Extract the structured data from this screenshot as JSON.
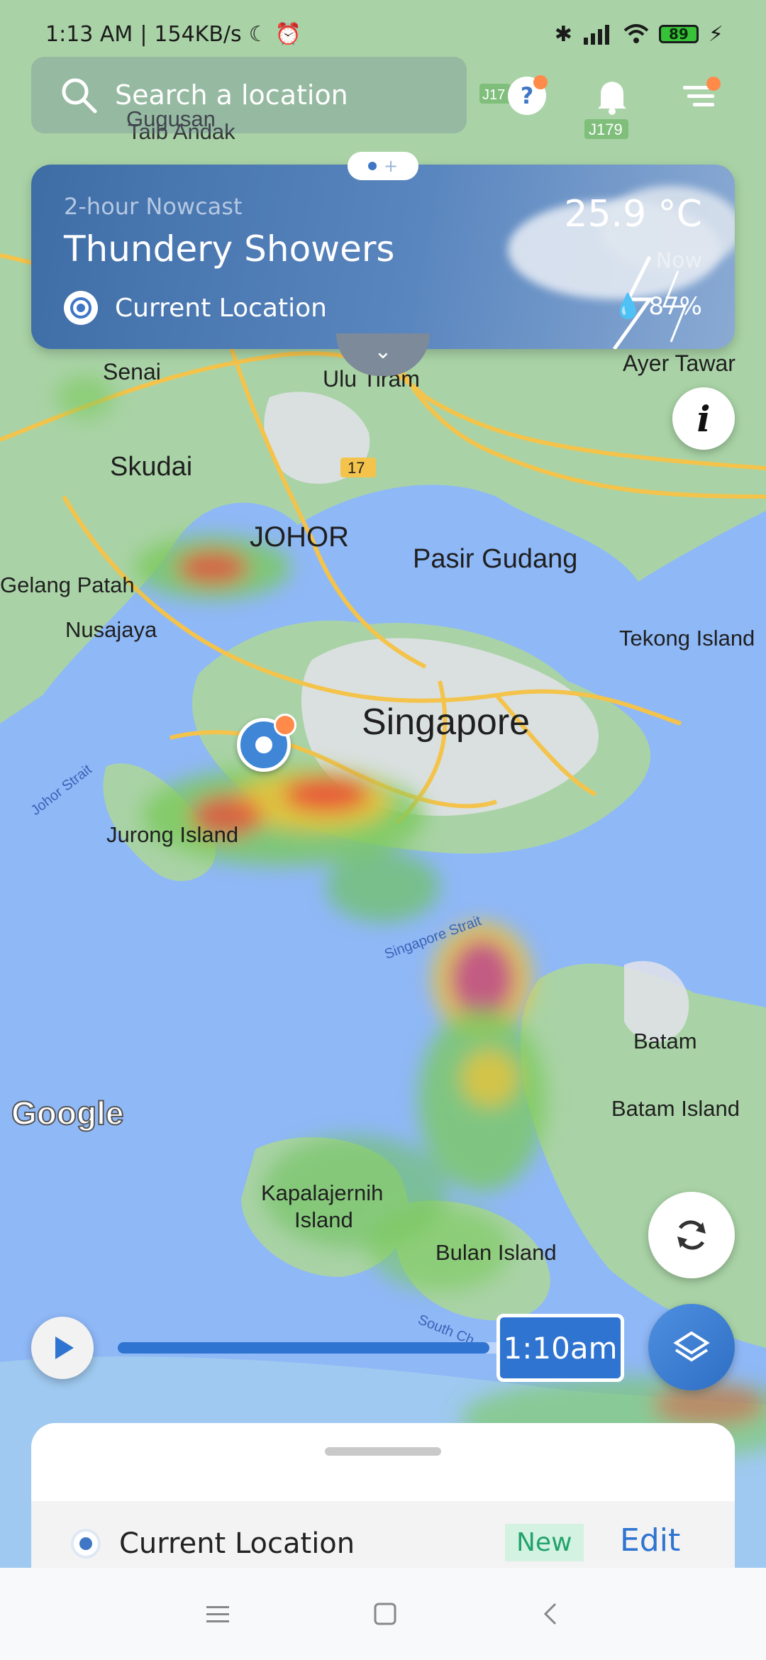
{
  "status_bar": {
    "time": "1:13 AM",
    "net_speed": "154KB/s",
    "battery": "89"
  },
  "search": {
    "placeholder": "Search a location"
  },
  "nowcast": {
    "label": "2-hour Nowcast",
    "condition": "Thundery Showers",
    "location": "Current Location",
    "temperature": "25.9 °C",
    "period": "Now",
    "humidity": "87%"
  },
  "map_labels": {
    "senai": "Senai",
    "ulu_tiram": "Ulu Tiram",
    "ayer_tawar": "Ayer Tawar",
    "skudai": "Skudai",
    "johor": "JOHOR",
    "pasir_gudang": "Pasir Gudang",
    "gelang_patah": "Gelang Patah",
    "nusajaya": "Nusajaya",
    "tekong": "Tekong Island",
    "singapore": "Singapore",
    "johor_strait": "Johor Strait",
    "jurong": "Jurong Island",
    "singapore_strait": "Singapore Strait",
    "batam": "Batam",
    "batam_island": "Batam Island",
    "kapala_1": "Kapalajernih",
    "kapala_2": "Island",
    "bulan": "Bulan Island",
    "south_china": "South Ch",
    "gugusan_1": "Gugusan",
    "gugusan_2": "Taib Andak",
    "road_17": "17",
    "road_j179": "J179",
    "road_j17": "J17",
    "google": "Google"
  },
  "timeline": {
    "time": "1:10am",
    "progress": 0.97
  },
  "sheet": {
    "location": "Current Location",
    "badge": "New",
    "edit": "Edit"
  },
  "colors": {
    "accent": "#2f74d0",
    "water": "#8fb8f7",
    "land": "#a9d3a6",
    "road": "#f4c34b",
    "new_badge_bg": "#d3f2e2",
    "new_badge_text": "#23a36b"
  }
}
